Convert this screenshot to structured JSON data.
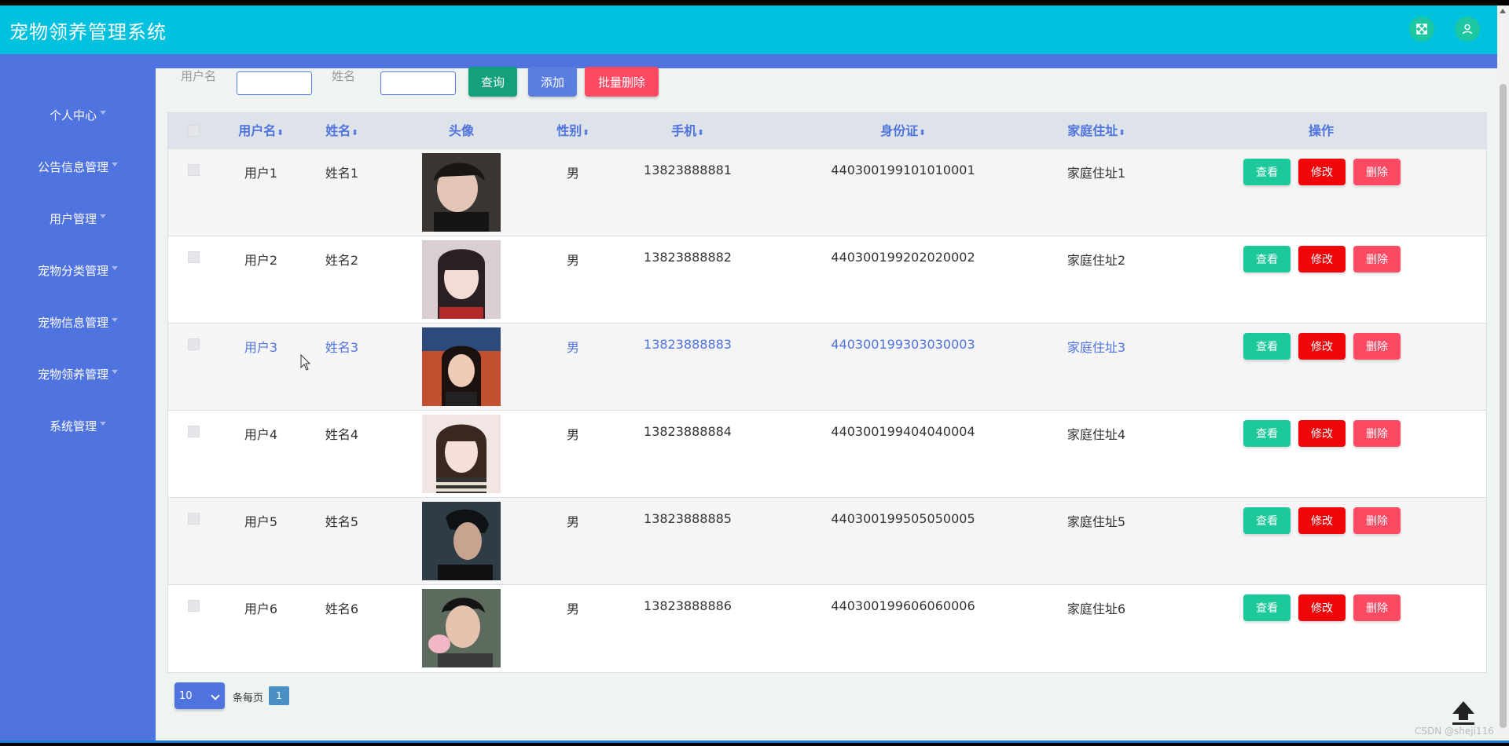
{
  "header": {
    "title": "宠物领养管理系统"
  },
  "sidebar": {
    "items": [
      {
        "label": "个人中心"
      },
      {
        "label": "公告信息管理"
      },
      {
        "label": "用户管理"
      },
      {
        "label": "宠物分类管理"
      },
      {
        "label": "宠物信息管理"
      },
      {
        "label": "宠物领养管理"
      },
      {
        "label": "系统管理"
      }
    ]
  },
  "search": {
    "username_label": "用户名",
    "name_label": "姓名",
    "query_button": "查询",
    "add_button": "添加",
    "batch_delete_button": "批量删除"
  },
  "table": {
    "headers": [
      "用户名",
      "姓名",
      "头像",
      "性别",
      "手机",
      "身份证",
      "家庭住址",
      "操作"
    ],
    "sort_icon": "⬍",
    "rows": [
      {
        "username": "用户1",
        "name": "姓名1",
        "gender": "男",
        "phone": "13823888881",
        "id_card": "440300199101010001",
        "address": "家庭住址1"
      },
      {
        "username": "用户2",
        "name": "姓名2",
        "gender": "男",
        "phone": "13823888882",
        "id_card": "440300199202020002",
        "address": "家庭住址2"
      },
      {
        "username": "用户3",
        "name": "姓名3",
        "gender": "男",
        "phone": "13823888883",
        "id_card": "440300199303030003",
        "address": "家庭住址3"
      },
      {
        "username": "用户4",
        "name": "姓名4",
        "gender": "男",
        "phone": "13823888884",
        "id_card": "440300199404040004",
        "address": "家庭住址4"
      },
      {
        "username": "用户5",
        "name": "姓名5",
        "gender": "男",
        "phone": "13823888885",
        "id_card": "440300199505050005",
        "address": "家庭住址5"
      },
      {
        "username": "用户6",
        "name": "姓名6",
        "gender": "男",
        "phone": "13823888886",
        "id_card": "440300199606060006",
        "address": "家庭住址6"
      }
    ],
    "actions": {
      "view": "查看",
      "edit": "修改",
      "delete": "删除"
    }
  },
  "pagination": {
    "page_size": "10",
    "per_page_label": "条每页",
    "current_page": "1"
  },
  "watermark": "CSDN @sheji116",
  "colors": {
    "header": "#00c1de",
    "sidebar": "#4f73df",
    "view": "#1dc99a",
    "edit": "#f0050b",
    "delete": "#ff4a63",
    "query": "#13a07a",
    "add": "#5a7ee0"
  }
}
